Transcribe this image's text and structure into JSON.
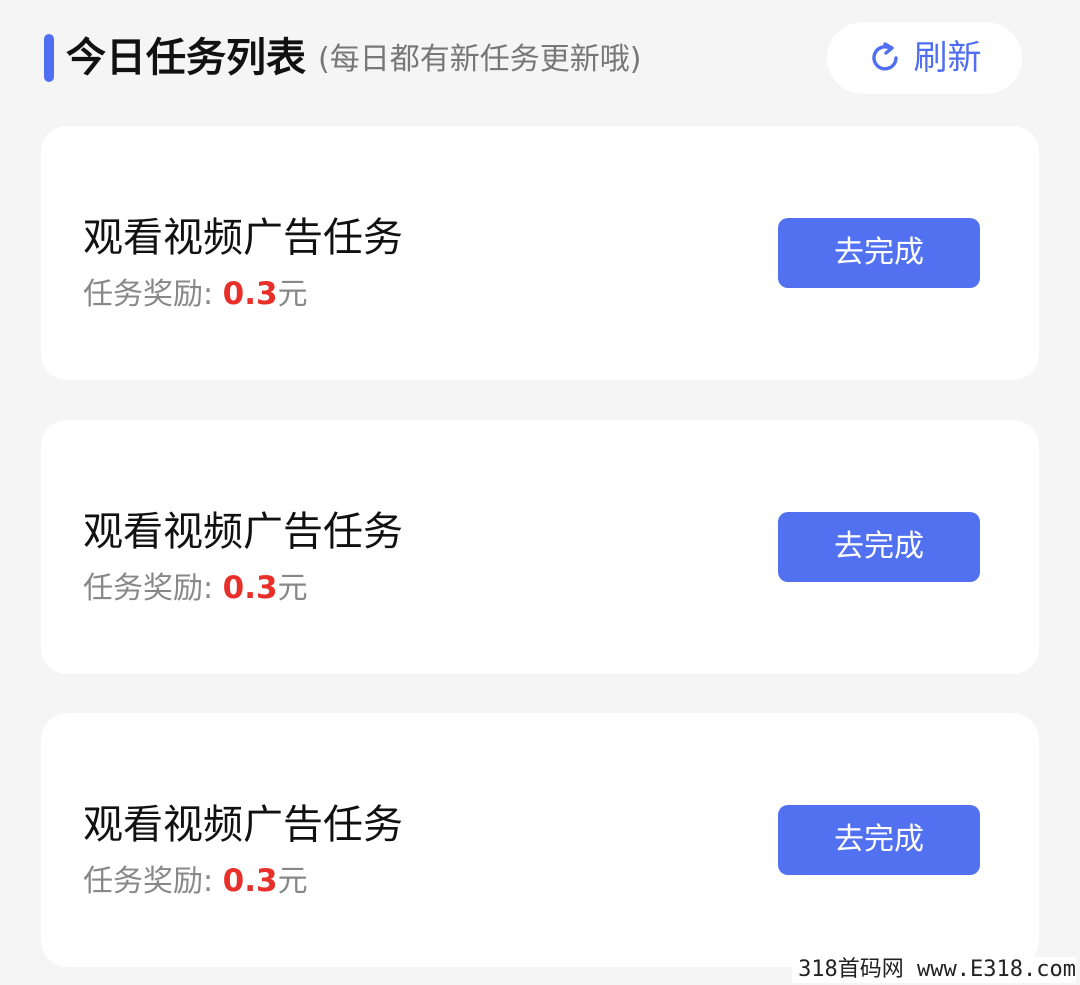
{
  "header": {
    "title": "今日任务列表",
    "subtitle": "(每日都有新任务更新哦)",
    "refresh_label": "刷新",
    "refresh_icon": "refresh-icon"
  },
  "colors": {
    "accent": "#4f6ef2",
    "button": "#5271f0",
    "reward": "#e8302a",
    "background": "#f5f5f5"
  },
  "tasks": [
    {
      "title": "观看视频广告任务",
      "reward_label": "任务奖励:",
      "reward_amount": "0.3",
      "reward_unit": "元",
      "button_label": "去完成"
    },
    {
      "title": "观看视频广告任务",
      "reward_label": "任务奖励:",
      "reward_amount": "0.3",
      "reward_unit": "元",
      "button_label": "去完成"
    },
    {
      "title": "观看视频广告任务",
      "reward_label": "任务奖励:",
      "reward_amount": "0.3",
      "reward_unit": "元",
      "button_label": "去完成"
    }
  ],
  "watermark": "318首码网 www.E318.com"
}
